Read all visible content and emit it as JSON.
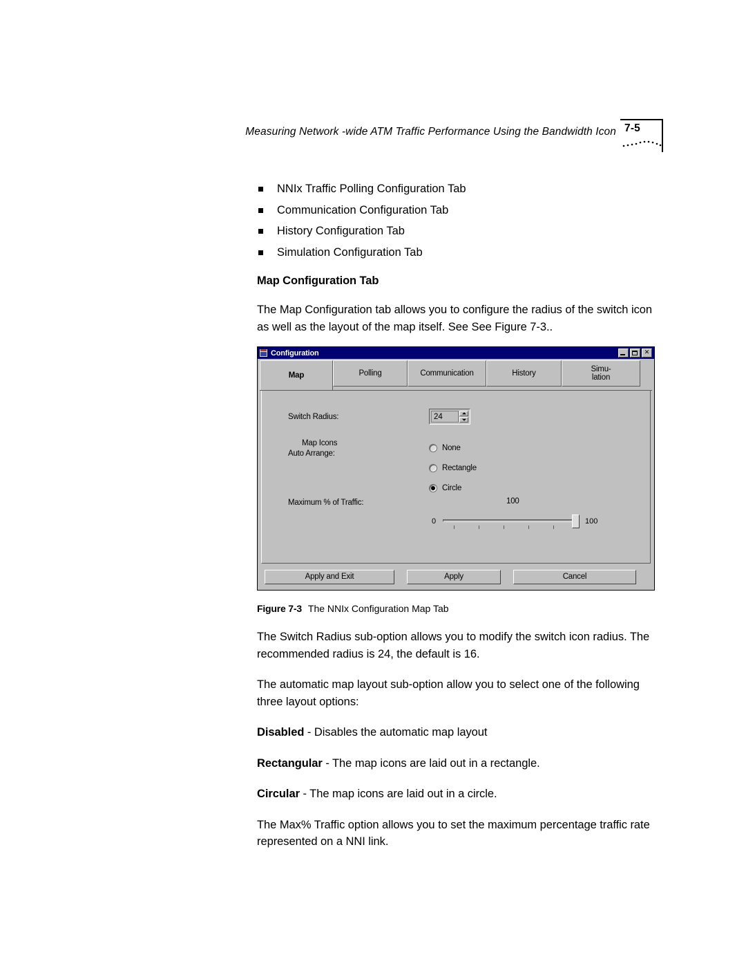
{
  "header": {
    "running_title": "Measuring Network -wide ATM Traffic Performance Using the Bandwidth Icon",
    "page_number": "7-5"
  },
  "bullets": [
    {
      "label": "NNIx Traffic Polling Configuration Tab"
    },
    {
      "label": "Communication Configuration Tab"
    },
    {
      "label": "History Configuration Tab"
    },
    {
      "label": "Simulation Configuration Tab"
    }
  ],
  "section": {
    "heading": "Map Configuration Tab",
    "intro": "The Map Configuration tab allows you to configure the radius of the switch icon as well as the layout of the map itself. See See Figure 7-3.."
  },
  "figure": {
    "label": "Figure 7-3",
    "title": "The NNIx Configuration Map Tab",
    "dialog": {
      "window_title": "Configuration",
      "window_icon": "application-icon",
      "title_buttons": [
        {
          "name": "minimize",
          "glyph": "minimize-icon"
        },
        {
          "name": "maximize",
          "glyph": "maximize-icon"
        },
        {
          "name": "close",
          "glyph": "close-icon",
          "char": "✕"
        }
      ],
      "tabs": [
        {
          "label": "Map",
          "selected": true
        },
        {
          "label": "Polling",
          "selected": false
        },
        {
          "label": "Communication",
          "selected": false
        },
        {
          "label": "History",
          "selected": false
        },
        {
          "label": "Simu-",
          "label2": "lation",
          "selected": false
        }
      ],
      "fields": {
        "switch_radius_label": "Switch Radius:",
        "switch_radius_value": "24",
        "auto_arrange_label_line1": "Map Icons",
        "auto_arrange_label_line2": "Auto Arrange:",
        "auto_arrange_options": [
          {
            "label": "None",
            "selected": false
          },
          {
            "label": "Rectangle",
            "selected": false
          },
          {
            "label": "Circle",
            "selected": true
          }
        ],
        "max_traffic_label": "Maximum % of Traffic:",
        "max_traffic_value": "100",
        "slider_min": "0",
        "slider_max": "100"
      },
      "buttons": {
        "apply_and_exit": "Apply and Exit",
        "apply": "Apply",
        "cancel": "Cancel"
      }
    }
  },
  "paragraphs": {
    "switch_radius": "The Switch Radius sub-option allows you to modify the switch icon radius. The recommended radius is 24, the default is 16.",
    "auto_layout": "The automatic map layout sub-option allow you to select one of the following three layout options:",
    "disabled_term": "Disabled",
    "disabled_desc": " - Disables the automatic map layout",
    "rectangular_term": "Rectangular",
    "rectangular_desc": " - The map icons are laid out in a rectangle.",
    "circular_term": "Circular",
    "circular_desc": " - The map icons are laid out in a circle.",
    "max_traffic": "The Max% Traffic option allows you to set the maximum percentage traffic rate represented on a NNI link."
  },
  "colors": {
    "titlebar": "#000080",
    "dialog_face": "#c0c0c0",
    "text": "#000000"
  }
}
